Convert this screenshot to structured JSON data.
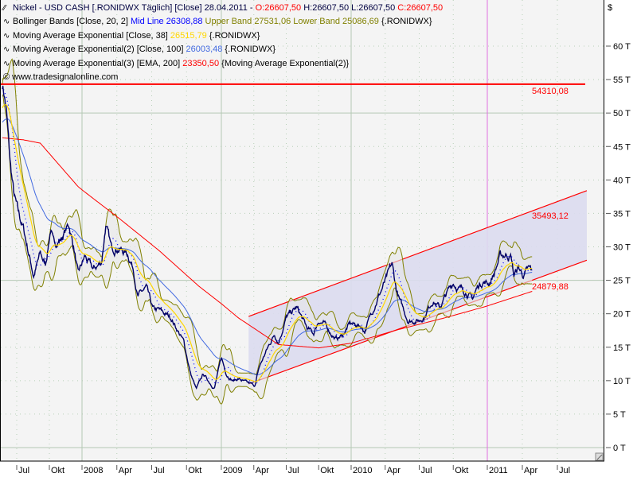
{
  "legend": {
    "main": {
      "name": "Nickel - USD CASH [.RONIDWX  Täglich] [Close] 28.04.2011 - ",
      "open": "O:26607,50",
      "hl": " H:26607,50 L:26607,50 ",
      "close": "C:26607,50"
    },
    "bollinger": {
      "name": "Bollinger Bands [Close, 20, 2] ",
      "mid": "Mid Line 26308,88",
      "upper": " Upper Band 27531,06",
      "lower": " Lower Band 25086,69",
      "suffix": " {.RONIDWX}"
    },
    "ema38": {
      "name": "Moving Average Exponential [Close, 38] ",
      "value": "26515,79",
      "suffix": " {.RONIDWX}"
    },
    "ema100": {
      "name": "Moving Average Exponential(2) [Close, 100] ",
      "value": "26003,48",
      "suffix": " {.RONIDWX}"
    },
    "ema200": {
      "name": "Moving Average Exponential(3) [EMA, 200] ",
      "value": "23350,50",
      "suffix": " {Moving Average Exponential(2)}"
    },
    "copyright": "© www.tradesignalonline.com"
  },
  "colors": {
    "price": "#000066",
    "ema38": "#ffd700",
    "ema100": "#4169e1",
    "ema200": "#ff0000",
    "bands": "#808000",
    "mid": "#0000ff",
    "channel": "#ff0000",
    "channel_fill": "#dcdcf0",
    "marker": "#e070e0"
  },
  "chart_data": {
    "type": "line",
    "title": "Nickel - USD CASH",
    "currency_label": "$",
    "y_unit": "T",
    "ylim": [
      0,
      60
    ],
    "y_ticks": [
      "0 T",
      "5 T",
      "10 T",
      "15 T",
      "20 T",
      "25 T",
      "30 T",
      "35 T",
      "40 T",
      "45 T",
      "50 T",
      "55 T",
      "60 T"
    ],
    "y_tick_values": [
      0,
      5,
      10,
      15,
      20,
      25,
      30,
      35,
      40,
      45,
      50,
      55,
      60
    ],
    "x_ticks": [
      {
        "t": 2007.5,
        "label": "Jul"
      },
      {
        "t": 2007.75,
        "label": "Okt"
      },
      {
        "t": 2008.0,
        "label": "2008"
      },
      {
        "t": 2008.25,
        "label": "Apr"
      },
      {
        "t": 2008.5,
        "label": "Jul"
      },
      {
        "t": 2008.75,
        "label": "Okt"
      },
      {
        "t": 2009.0,
        "label": "2009"
      },
      {
        "t": 2009.25,
        "label": "Apr"
      },
      {
        "t": 2009.5,
        "label": "Jul"
      },
      {
        "t": 2009.75,
        "label": "Okt"
      },
      {
        "t": 2010.0,
        "label": "2010"
      },
      {
        "t": 2010.25,
        "label": "Apr"
      },
      {
        "t": 2010.5,
        "label": "Jul"
      },
      {
        "t": 2010.75,
        "label": "Okt"
      },
      {
        "t": 2011.0,
        "label": "2011"
      },
      {
        "t": 2011.25,
        "label": "Apr"
      },
      {
        "t": 2011.5,
        "label": "Jul"
      }
    ],
    "price_keypoints": [
      [
        2007.39,
        54.4
      ],
      [
        2007.4,
        53.5
      ],
      [
        2007.42,
        50.6
      ],
      [
        2007.45,
        42.3
      ],
      [
        2007.48,
        37.5
      ],
      [
        2007.51,
        35
      ],
      [
        2007.55,
        32.8
      ],
      [
        2007.63,
        25.7
      ],
      [
        2007.68,
        28.9
      ],
      [
        2007.72,
        27.3
      ],
      [
        2007.76,
        32.8
      ],
      [
        2007.78,
        30.4
      ],
      [
        2007.84,
        31.2
      ],
      [
        2007.9,
        33.3
      ],
      [
        2007.94,
        29.7
      ],
      [
        2007.97,
        25.7
      ],
      [
        2008.02,
        28.5
      ],
      [
        2008.08,
        26.5
      ],
      [
        2008.14,
        27.7
      ],
      [
        2008.17,
        33.3
      ],
      [
        2008.21,
        29.7
      ],
      [
        2008.25,
        30.0
      ],
      [
        2008.33,
        28.9
      ],
      [
        2008.37,
        26.8
      ],
      [
        2008.4,
        22.6
      ],
      [
        2008.46,
        23.8
      ],
      [
        2008.51,
        20.5
      ],
      [
        2008.55,
        20.5
      ],
      [
        2008.64,
        19.4
      ],
      [
        2008.73,
        15.8
      ],
      [
        2008.78,
        11
      ],
      [
        2008.82,
        8.7
      ],
      [
        2008.87,
        11
      ],
      [
        2008.91,
        9.9
      ],
      [
        2008.95,
        8.9
      ],
      [
        2009.0,
        13.4
      ],
      [
        2009.04,
        11
      ],
      [
        2009.09,
        10
      ],
      [
        2009.13,
        10.3
      ],
      [
        2009.2,
        9.6
      ],
      [
        2009.26,
        9.3
      ],
      [
        2009.29,
        11.9
      ],
      [
        2009.35,
        14.6
      ],
      [
        2009.41,
        17
      ],
      [
        2009.44,
        15.8
      ],
      [
        2009.5,
        19.4
      ],
      [
        2009.58,
        20.9
      ],
      [
        2009.61,
        19.8
      ],
      [
        2009.66,
        17.8
      ],
      [
        2009.71,
        17
      ],
      [
        2009.75,
        19
      ],
      [
        2009.79,
        18.5
      ],
      [
        2009.85,
        17
      ],
      [
        2009.88,
        16.2
      ],
      [
        2009.93,
        16.7
      ],
      [
        2009.99,
        18.5
      ],
      [
        2010.07,
        18.2
      ],
      [
        2010.1,
        17.4
      ],
      [
        2010.15,
        20.2
      ],
      [
        2010.19,
        22.1
      ],
      [
        2010.27,
        25.7
      ],
      [
        2010.3,
        27.3
      ],
      [
        2010.33,
        23.8
      ],
      [
        2010.36,
        21.7
      ],
      [
        2010.42,
        19
      ],
      [
        2010.5,
        19
      ],
      [
        2010.54,
        19.7
      ],
      [
        2010.6,
        22.1
      ],
      [
        2010.65,
        20.9
      ],
      [
        2010.71,
        23.3
      ],
      [
        2010.75,
        24.7
      ],
      [
        2010.79,
        23.8
      ],
      [
        2010.85,
        23.3
      ],
      [
        2010.89,
        22.1
      ],
      [
        2010.93,
        24.1
      ],
      [
        2010.97,
        24.9
      ],
      [
        2011.01,
        24.5
      ],
      [
        2011.05,
        26.1
      ],
      [
        2011.09,
        28.5
      ],
      [
        2011.14,
        28.9
      ],
      [
        2011.17,
        28.5
      ],
      [
        2011.19,
        25.7
      ],
      [
        2011.22,
        26.9
      ],
      [
        2011.26,
        25.7
      ],
      [
        2011.29,
        26.5
      ],
      [
        2011.32,
        26.6
      ]
    ],
    "ema200_keypoints": [
      [
        2007.39,
        46.3
      ],
      [
        2007.55,
        46.0
      ],
      [
        2007.68,
        45.5
      ],
      [
        2007.97,
        39
      ],
      [
        2008.27,
        34.2
      ],
      [
        2008.55,
        29.5
      ],
      [
        2008.84,
        24.1
      ],
      [
        2009.13,
        19.4
      ],
      [
        2009.44,
        15.4
      ],
      [
        2009.75,
        14.9
      ],
      [
        2010.0,
        15.6
      ],
      [
        2010.34,
        17.6
      ],
      [
        2010.69,
        19.4
      ],
      [
        2010.99,
        21.1
      ],
      [
        2011.32,
        23.35
      ]
    ],
    "ema_seeds": {
      "ema38": 50.6,
      "ema100": 48.5
    },
    "channel": {
      "upper": [
        [
          2009.21,
          19.6
        ],
        [
          2011.71,
          38.4
        ]
      ],
      "lower": [
        [
          2009.21,
          9.5
        ],
        [
          2011.71,
          28.0
        ]
      ]
    },
    "horizontal_line": {
      "value": 54.31008,
      "label": "54310,08"
    },
    "channel_labels": {
      "upper": "35493,12",
      "lower": "24879,88"
    },
    "marker_time": 2011.0
  }
}
